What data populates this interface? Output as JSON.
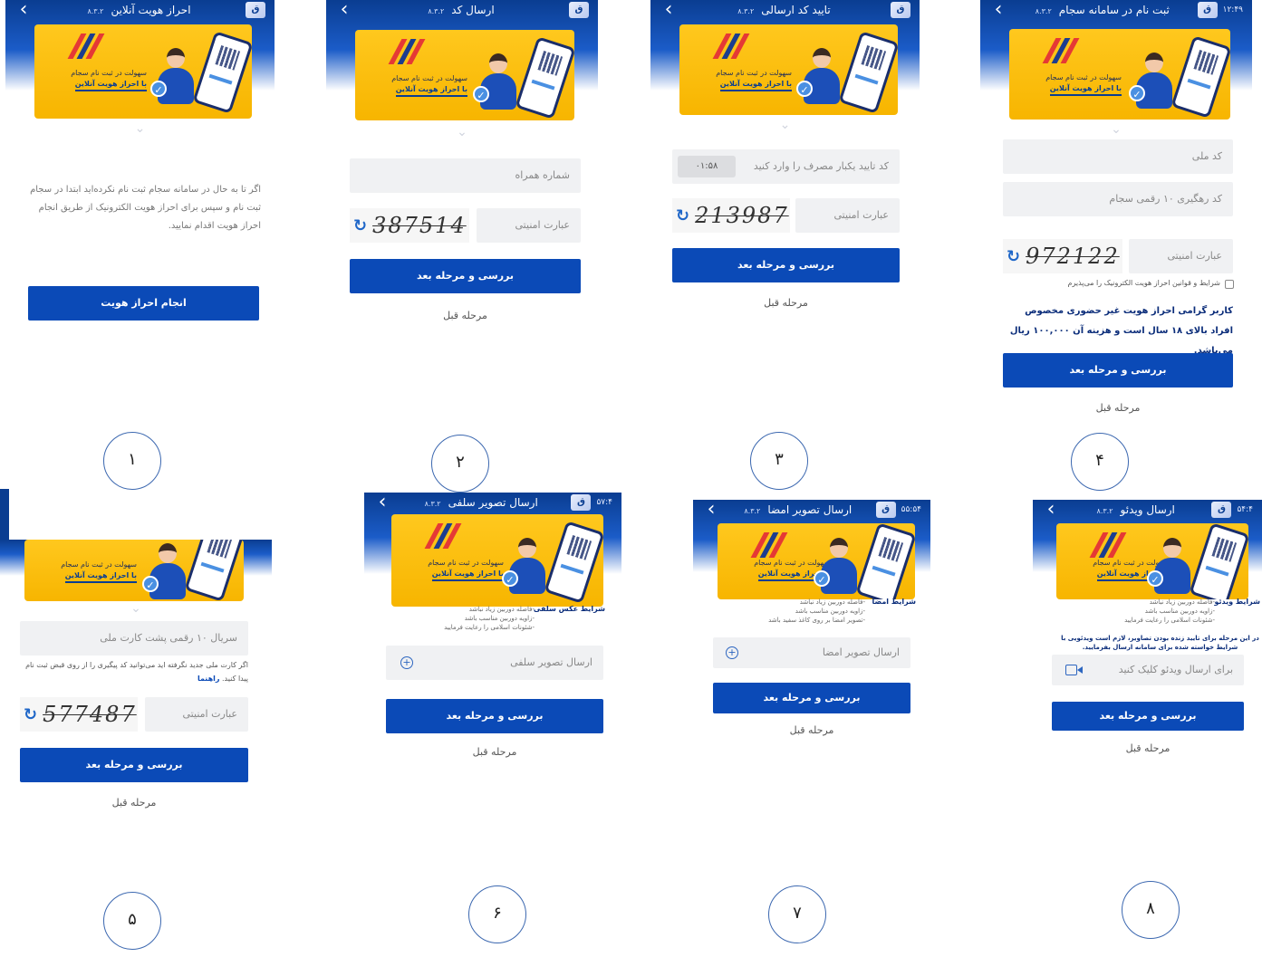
{
  "app": {
    "version": "۸.۳.۲",
    "logo_text": "ق",
    "banner_line1": "سهولت در ثبت نام سجام",
    "banner_line2": "با احراز هویت آنلاین",
    "next_label": "بررسی و مرحله بعد",
    "prev_label": "مرحله قبل",
    "captcha_placeholder": "عبارت امنیتی",
    "brand_blue": "#0b4ab7",
    "banner_yellow": "#ffc81e"
  },
  "screens": [
    {
      "id": 1,
      "title": "احراز هویت آنلاین",
      "clock": "",
      "intro_text": "اگر تا به حال در سامانه سجام ثبت نام نکرده‌اید ابتدا در سجام ثبت نام و سپس برای احراز هویت الکترونیک از طریق انجام احراز هویت اقدام نمایید.",
      "action_label": "انجام احراز هویت",
      "step_number": "۱"
    },
    {
      "id": 2,
      "title": "ارسال کد",
      "clock": "",
      "phone_placeholder": "شماره همراه",
      "captcha_code": "387514",
      "step_number": "۲"
    },
    {
      "id": 3,
      "title": "تایید کد ارسالی",
      "clock": "",
      "otp_placeholder": "کد تایید یکبار مصرف را وارد کنید",
      "timer": "۰۱:۵۸",
      "captcha_code": "213987",
      "step_number": "۳"
    },
    {
      "id": 4,
      "title": "ثبت نام در سامانه سجام",
      "clock": "۱۲:۴۹",
      "national_code_placeholder": "کد ملی",
      "tracking_placeholder": "کد رهگیری ۱۰ رقمی سجام",
      "captcha_code": "972122",
      "terms_label": "شرایط و قوانین احراز هویت الکترونیک را می‌پذیرم",
      "warning_text": "کاربر گرامی احراز هویت غیر حضوری مخصوص افراد بالای ۱۸ سال است و هزینه آن ۱۰۰,۰۰۰ ریال می‌باشد.",
      "step_number": "۴"
    },
    {
      "id": 5,
      "title": "",
      "clock": "",
      "serial_placeholder": "سریال ۱۰ رقمی پشت کارت ملی",
      "serial_note": "اگر کارت ملی جدید نگرفته اید می‌توانید کد پیگیری را از روی قبض ثبت نام پیدا کنید.",
      "guide_link": "راهنما",
      "captcha_code": "577487",
      "step_number": "۵"
    },
    {
      "id": 6,
      "title": "ارسال تصویر سلفی",
      "clock": "۵۷:۴",
      "section_title": "شرایط عکس سلفی",
      "bullets": [
        "-فاصله دوربین زیاد نباشد",
        "-زاویه دوربین مناسب باشد",
        "-شئونات اسلامی را رعایت فرمایید"
      ],
      "upload_label": "ارسال تصویر سلفی",
      "step_number": "۶"
    },
    {
      "id": 7,
      "title": "ارسال تصویر امضا",
      "clock": "۵۵:۵۴",
      "section_title": "شرایط امضا",
      "bullets": [
        "-فاصله دوربین زیاد نباشد",
        "-زاویه دوربین مناسب باشد",
        "-تصویر امضا بر روی کاغذ سفید باشد"
      ],
      "upload_label": "ارسال تصویر امضا",
      "step_number": "۷"
    },
    {
      "id": 8,
      "title": "ارسال ویدئو",
      "clock": "۵۴:۴",
      "section_title": "شرایط ویدئو",
      "bullets": [
        "-فاصله دوربین زیاد نباشد",
        "-زاویه دوربین مناسب باشد",
        "-شئونات اسلامی را رعایت فرمایید"
      ],
      "video_note": "در این مرحله برای تایید زنده بودن تصاویر، لازم است ویدئویی با شرایط خواسته شده برای سامانه ارسال بفرمایید.",
      "video_label": "برای ارسال ویدئو کلیک کنید",
      "step_number": "۸"
    }
  ]
}
